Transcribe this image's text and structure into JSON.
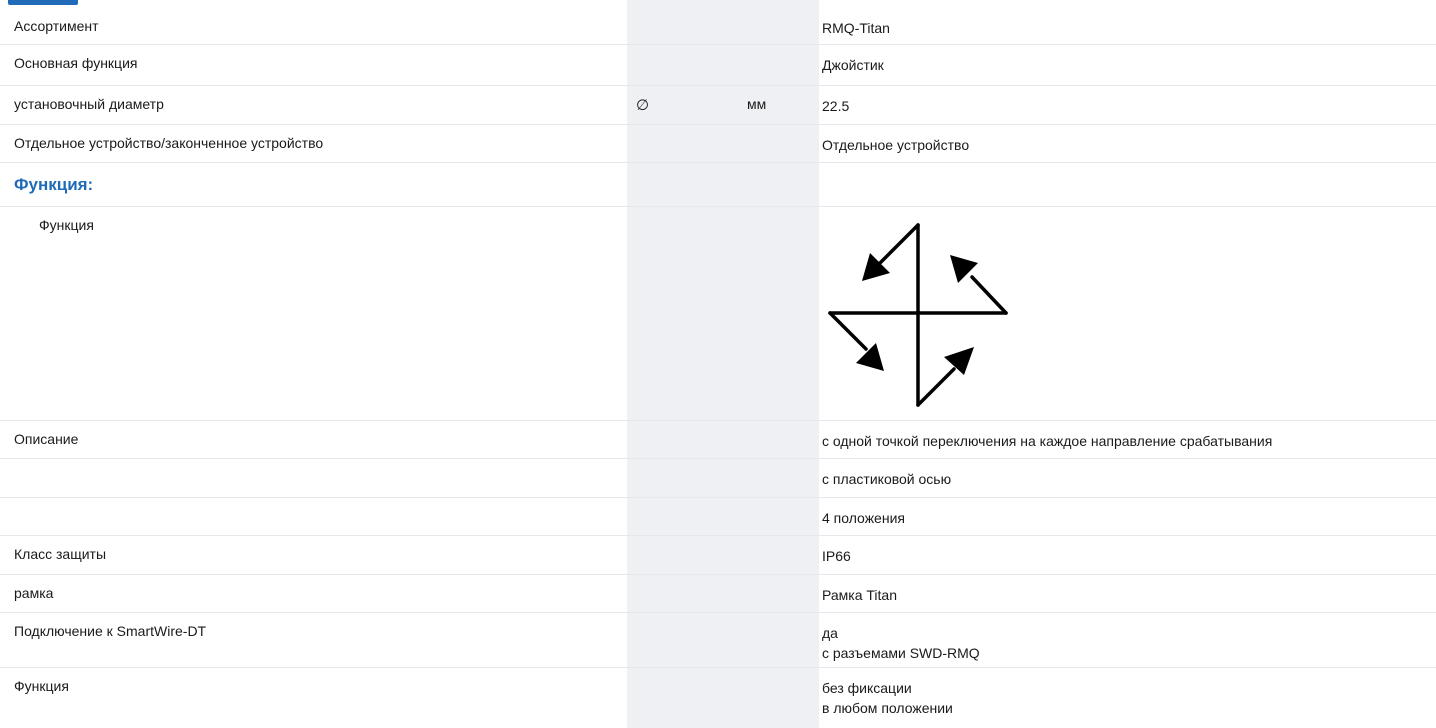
{
  "rows": [
    {
      "label": "Ассортимент",
      "value": "RMQ-Titan"
    },
    {
      "label": "Основная функция",
      "value": "Джойстик"
    },
    {
      "label": "установочный диаметр",
      "symbol": "∅",
      "unit": "мм",
      "value": "22.5"
    },
    {
      "label": "Отдельное устройство/законченное устройство",
      "value": "Отдельное устройство"
    }
  ],
  "section_title": "Функция:",
  "function_row": {
    "label": "Функция",
    "icon": "joystick-four-direction-icon"
  },
  "description": {
    "label": "Описание",
    "lines": [
      "с одной точкой переключения на каждое направление срабатывания",
      "с пластиковой осью",
      "4 положения"
    ]
  },
  "rows2": [
    {
      "label": "Класс защиты",
      "value": "IP66"
    },
    {
      "label": "рамка",
      "value": "Рамка Titan"
    }
  ],
  "smartwire": {
    "label": "Подключение к SmartWire-DT",
    "lines": [
      "да",
      "с разъемами SWD-RMQ"
    ]
  },
  "function2": {
    "label": "Функция",
    "lines": [
      "без фиксации",
      "в любом положении"
    ]
  },
  "colors": {
    "accent": "#1f6bb8",
    "shade": "#eef0f4",
    "divider": "#e6e8ec"
  }
}
